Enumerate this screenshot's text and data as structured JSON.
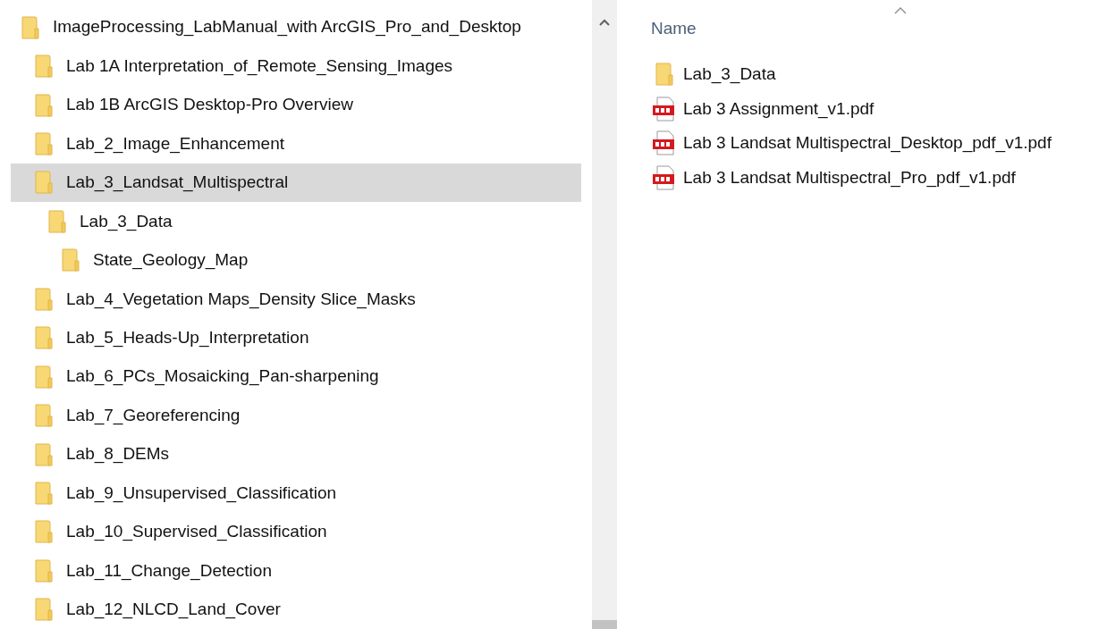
{
  "tree": [
    {
      "name": "ImageProcessing_LabManual_with ArcGIS_Pro_and_Desktop",
      "selected": false,
      "children": [
        {
          "name": "Lab 1A Interpretation_of_Remote_Sensing_Images",
          "selected": false
        },
        {
          "name": "Lab 1B ArcGIS Desktop-Pro Overview",
          "selected": false
        },
        {
          "name": "Lab_2_Image_Enhancement",
          "selected": false
        },
        {
          "name": "Lab_3_Landsat_Multispectral",
          "selected": true,
          "children": [
            {
              "name": "Lab_3_Data",
              "selected": false,
              "children": [
                {
                  "name": "State_Geology_Map",
                  "selected": false
                }
              ]
            }
          ]
        },
        {
          "name": "Lab_4_Vegetation Maps_Density Slice_Masks",
          "selected": false
        },
        {
          "name": "Lab_5_Heads-Up_Interpretation",
          "selected": false
        },
        {
          "name": "Lab_6_PCs_Mosaicking_Pan-sharpening",
          "selected": false
        },
        {
          "name": "Lab_7_Georeferencing",
          "selected": false
        },
        {
          "name": "Lab_8_DEMs",
          "selected": false
        },
        {
          "name": "Lab_9_Unsupervised_Classification",
          "selected": false
        },
        {
          "name": "Lab_10_Supervised_Classification",
          "selected": false
        },
        {
          "name": "Lab_11_Change_Detection",
          "selected": false
        },
        {
          "name": "Lab_12_NLCD_Land_Cover",
          "selected": false
        }
      ]
    }
  ],
  "file_list": {
    "columns": [
      "Name"
    ],
    "files": [
      {
        "name": "Lab_3_Data",
        "kind": "folder"
      },
      {
        "name": "Lab 3 Assignment_v1.pdf",
        "kind": "pdf"
      },
      {
        "name": "Lab 3 Landsat Multispectral_Desktop_pdf_v1.pdf",
        "kind": "pdf"
      },
      {
        "name": "Lab 3 Landsat Multispectral_Pro_pdf_v1.pdf",
        "kind": "pdf"
      }
    ]
  }
}
